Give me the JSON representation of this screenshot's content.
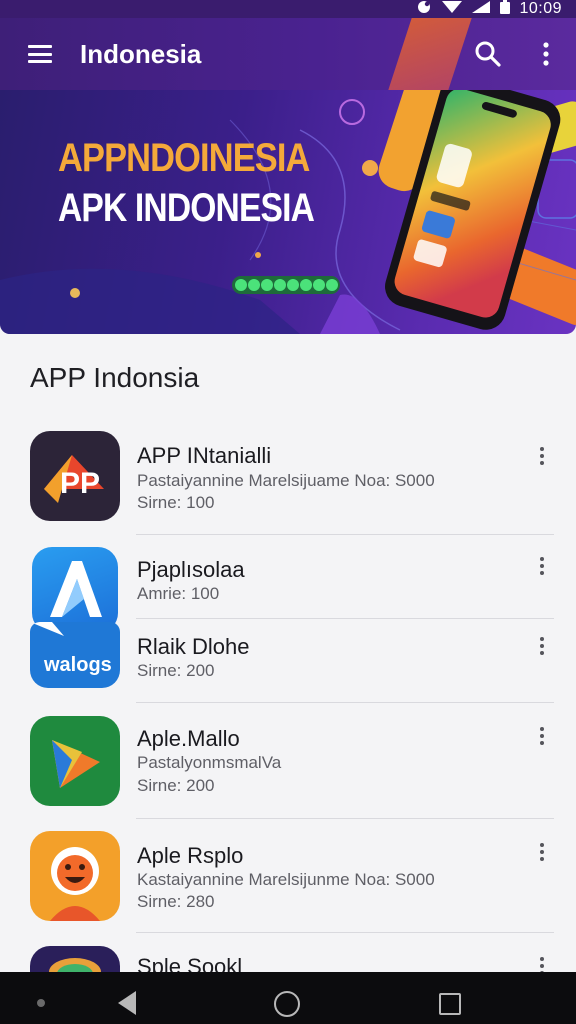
{
  "status_bar": {
    "time": "10:09"
  },
  "app_bar": {
    "title": "Indonesia",
    "menu_icon": "hamburger-menu-icon",
    "search_icon": "search-icon",
    "more_icon": "more-vert-icon"
  },
  "banner": {
    "title_line1": "APPNDOINESIA",
    "title_line2": "APK INDONESIA"
  },
  "section_title": "APP Indonsia",
  "apps": [
    {
      "name": "APP INtanialli",
      "description": "Pastaiyannine Marelsijuame Noa: S000",
      "size": "Sirne: 100",
      "icon": "pp-app-icon"
    },
    {
      "name": "Pjaplısolaa",
      "description": "",
      "size": "Amrie: 100",
      "icon": "letter-a-app-icon"
    },
    {
      "name": "Rlaik Dlohe",
      "description": "",
      "size": "Sirne: 200",
      "icon": "walogs-app-icon"
    },
    {
      "name": "Aple.Mallo",
      "description": "PastalyonmsmalVa",
      "size": "Sirne: 200",
      "icon": "play-triangle-app-icon"
    },
    {
      "name": "Aple Rsplo",
      "description": "Kastaiyannine Marelsijunme Noa: S000",
      "size": "Sirne: 280",
      "icon": "smiley-app-icon"
    },
    {
      "name": "Sple Sookl",
      "description": "",
      "size": "",
      "icon": "partial-app-icon"
    }
  ],
  "icon_texts": {
    "pp": "PP",
    "walogs": "walogs"
  },
  "nav_bar": {
    "back_icon": "back-triangle-icon",
    "home_icon": "home-circle-icon",
    "recents_icon": "recents-square-icon"
  }
}
